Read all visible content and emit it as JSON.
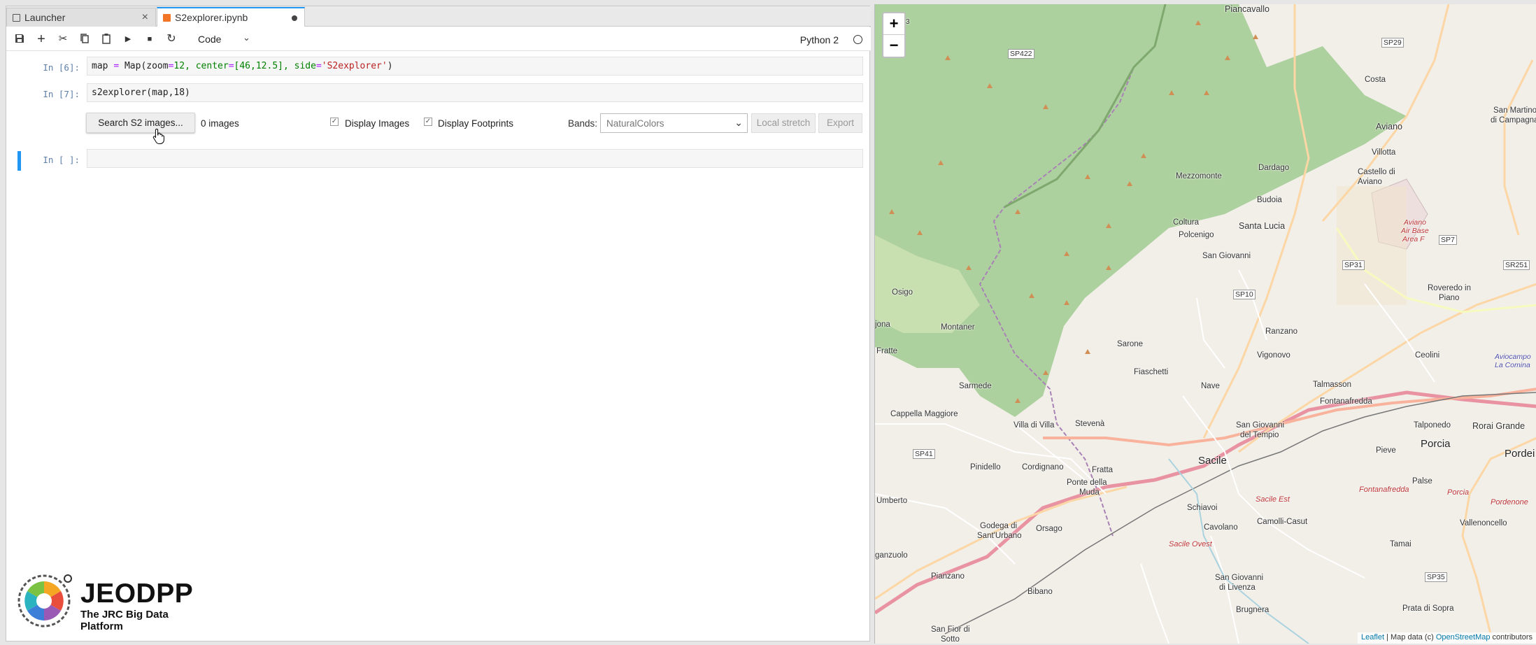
{
  "tabs": [
    {
      "label": "Launcher",
      "active": false
    },
    {
      "label": "S2explorer.ipynb",
      "active": true
    }
  ],
  "toolbar": {
    "cell_type": "Code",
    "kernel": "Python 2"
  },
  "cells": [
    {
      "prompt": "In [6]:",
      "code": {
        "a": "map ",
        "op": "=",
        "b": " Map(zoom",
        "op2": "=",
        "c": "12, center",
        "op3": "=",
        "d": "[46,12.5], side",
        "op4": "=",
        "e": "'S2explorer'",
        "f": ")"
      }
    },
    {
      "prompt": "In [7]:",
      "code_text": "s2explorer(map,18)"
    },
    {
      "prompt": "In [ ]:",
      "code_text": ""
    }
  ],
  "widget": {
    "search_label": "Search S2 images...",
    "image_count": "0 images",
    "display_images_label": "Display Images",
    "display_images_checked": true,
    "display_footprints_label": "Display Footprints",
    "display_footprints_checked": true,
    "bands_label": "Bands:",
    "bands_value": "NaturalColors",
    "local_stretch_label": "Local stretch",
    "export_label": "Export"
  },
  "logo": {
    "title": "JEODPP",
    "subtitle": "The JRC Big Data Platform"
  },
  "map": {
    "zoom_in": "+",
    "zoom_out": "−",
    "attribution_leaflet": "Leaflet",
    "attribution_mid": " | Map data (c) ",
    "attribution_osm": "OpenStreetMap",
    "attribution_tail": " contributors",
    "labels": {
      "piancavallo": "Piancavallo",
      "sp422": "SP422",
      "sp29": "SP29",
      "costa": "Costa",
      "castello": "Castello di",
      "castello2": "Aviano",
      "san_martino": "San Martino",
      "san_martino2": "di Campagna",
      "aviano": "Aviano",
      "villotta": "Villotta",
      "dardago": "Dardago",
      "mezzomonte": "Mezzomonte",
      "budoia": "Budoia",
      "coltura": "Coltura",
      "santa_lucia": "Santa Lucia",
      "polcenigo": "Polcenigo",
      "aviano_air": "Aviano",
      "aviano_air2": "Air Base",
      "aviano_air3": "Area F",
      "sp7": "SP7",
      "san_giovanni": "San Giovanni",
      "sp31": "SP31",
      "sr251": "SR251",
      "osigo": "Osigo",
      "sp10": "SP10",
      "roveredo": "Roveredo in",
      "roveredo2": "Piano",
      "jona": "jona",
      "montaner": "Montaner",
      "ranzano": "Ranzano",
      "sarone": "Sarone",
      "aviocampo": "Aviocampo",
      "aviocampo2": "La Comina",
      "fratte": "Fratte",
      "vigonovo": "Vigonovo",
      "ceolini": "Ceolini",
      "fiaschetti": "Fiaschetti",
      "sarmede": "Sarmede",
      "nave": "Nave",
      "talmasson": "Talmasson",
      "fontanafredda": "Fontanafredda",
      "cappella": "Cappella Maggiore",
      "villa_di_villa": "Villa di Villa",
      "stevena": "Stevenà",
      "sgdt": "San Giovanni",
      "sgdt2": "del Tempio",
      "talponedo": "Talponedo",
      "rorai": "Rorai Grande",
      "porcia": "Porcia",
      "pordenone": "Pordei",
      "sp41": "SP41",
      "sacile": "Sacile",
      "pinidello": "Pinidello",
      "cordignano": "Cordignano",
      "fratta": "Fratta",
      "pieve": "Pieve",
      "ponte": "Ponte della",
      "ponte2": "Muda",
      "palse": "Palse",
      "fontanafredda_ital": "Fontanafredda",
      "porcia_ital": "Porcia",
      "pordenone_ital": "Pordenone",
      "umberto": "Umberto",
      "sacile_est": "Sacile Est",
      "schiavoi": "Schiavoi",
      "camolli": "Camolli-Casut",
      "vallenoncello": "Vallenoncello",
      "godega": "Godega di",
      "godega2": "Sant'Urbano",
      "orsago": "Orsago",
      "cavolano": "Cavolano",
      "tamai": "Tamai",
      "sacile_ovest": "Sacile Ovest",
      "ganzuolo": "ganzuolo",
      "pianzano": "Pianzano",
      "sgdl": "San Giovanni",
      "sgdl2": "di Livenza",
      "sp35": "SP35",
      "bibano": "Bibano",
      "san_fior": "San Fior di",
      "san_fior2": "Sotto",
      "brugnera": "Brugnera",
      "prata": "Prata di Sopra",
      "num3": "3"
    }
  }
}
